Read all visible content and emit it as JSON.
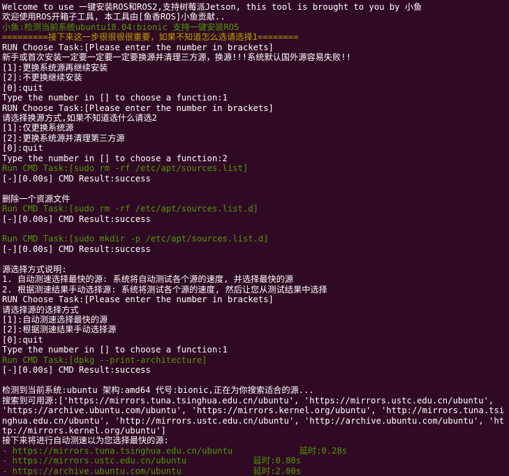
{
  "terminal": {
    "background": "#300a24",
    "colors": {
      "white": "#ffffff",
      "green": "#4e9a06",
      "yellow": "#c4a000"
    },
    "lines": [
      {
        "color": "white",
        "text": "Welcome to use 一键安装ROS和ROS2,支持树莓派Jetson, this tool is brought to you by 小鱼"
      },
      {
        "color": "white",
        "text": "欢迎使用ROS开箱子工具, 本工具由[鱼香ROS]小鱼贡献.."
      },
      {
        "color": "green",
        "text": "小鱼:检测当前系统ubuntu18.04:bionic 支持一键安装ROS"
      },
      {
        "color": "yellow",
        "text": "=========接下来这一步很很很很重要，如果不知道怎么选请选择1========"
      },
      {
        "color": "white",
        "text": "RUN Choose Task:[Please enter the number in brackets]"
      },
      {
        "color": "white",
        "text": "新手或首次安装一定要一定要一定要换源并清理三方源，换源!!!系统默认国外源容易失败!!"
      },
      {
        "color": "white",
        "text": "[1]:更换系统源再继续安装"
      },
      {
        "color": "white",
        "text": "[2]:不更换继续安装"
      },
      {
        "color": "white",
        "text": "[0]:quit"
      },
      {
        "color": "white",
        "text": "Type the number in [] to choose a function:1"
      },
      {
        "color": "white",
        "text": "RUN Choose Task:[Please enter the number in brackets]"
      },
      {
        "color": "white",
        "text": "请选择换源方式,如果不知道选什么请选2"
      },
      {
        "color": "white",
        "text": "[1]:仅更换系统源"
      },
      {
        "color": "white",
        "text": "[2]:更换系统源并清理第三方源"
      },
      {
        "color": "white",
        "text": "[0]:quit"
      },
      {
        "color": "white",
        "text": "Type the number in [] to choose a function:2"
      },
      {
        "color": "green",
        "text": "Run CMD Task:[sudo rm -rf /etc/apt/sources.list]"
      },
      {
        "color": "white",
        "text": "[-][0.00s] CMD Result:success"
      },
      {
        "color": "white",
        "text": ""
      },
      {
        "color": "white",
        "text": "删除一个资源文件"
      },
      {
        "color": "green",
        "text": "Run CMD Task:[sudo rm -rf /etc/apt/sources.list.d]"
      },
      {
        "color": "white",
        "text": "[-][0.00s] CMD Result:success"
      },
      {
        "color": "white",
        "text": ""
      },
      {
        "color": "green",
        "text": "Run CMD Task:[sudo mkdir -p /etc/apt/sources.list.d]"
      },
      {
        "color": "white",
        "text": "[-][0.00s] CMD Result:success"
      },
      {
        "color": "white",
        "text": ""
      },
      {
        "color": "white",
        "text": "源选择方式说明:"
      },
      {
        "color": "white",
        "text": "1. 自动测速选择最快的源: 系统将自动测试各个源的速度, 并选择最快的源"
      },
      {
        "color": "white",
        "text": "2. 根据测速结果手动选择源: 系统将测试各个源的速度, 然后让您从测试结果中选择"
      },
      {
        "color": "white",
        "text": "RUN Choose Task:[Please enter the number in brackets]"
      },
      {
        "color": "white",
        "text": "请选择源的选择方式"
      },
      {
        "color": "white",
        "text": "[1]:自动测速选择最快的源"
      },
      {
        "color": "white",
        "text": "[2]:根据测速结果手动选择源"
      },
      {
        "color": "white",
        "text": "[0]:quit"
      },
      {
        "color": "white",
        "text": "Type the number in [] to choose a function:1"
      },
      {
        "color": "green",
        "text": "Run CMD Task:[dpkg --print-architecture]"
      },
      {
        "color": "white",
        "text": "[-][0.00s] CMD Result:success"
      },
      {
        "color": "white",
        "text": ""
      },
      {
        "color": "white",
        "text": "检测到当前系统:ubuntu 架构:amd64 代号:bionic,正在为你搜索适合的源..."
      },
      {
        "color": "white",
        "wrap": true,
        "text": "搜索到可用源:['https://mirrors.tuna.tsinghua.edu.cn/ubuntu', 'https://mirrors.ustc.edu.cn/ubuntu', 'https://archive.ubuntu.com/ubuntu', 'https://mirrors.kernel.org/ubuntu', 'http://mirrors.tuna.tsinghua.edu.cn/ubuntu', 'http://mirrors.ustc.edu.cn/ubuntu', 'http://archive.ubuntu.com/ubuntu', 'http://mirrors.kernel.org/ubuntu']"
      },
      {
        "color": "white",
        "text": "接下来将进行自动测速以为您选择最快的源:"
      },
      {
        "color": "green",
        "text": "- https://mirrors.tuna.tsinghua.edu.cn/ubuntu",
        "latency": "延时:0.28s",
        "gap": 13
      },
      {
        "color": "green",
        "text": "- https://mirrors.ustc.edu.cn/ubuntu",
        "latency": "延时:0.80s",
        "gap": 13
      },
      {
        "color": "green",
        "text": "- https://archive.ubuntu.com/ubuntu",
        "latency": "延时:2.00s",
        "gap": 14
      }
    ]
  }
}
